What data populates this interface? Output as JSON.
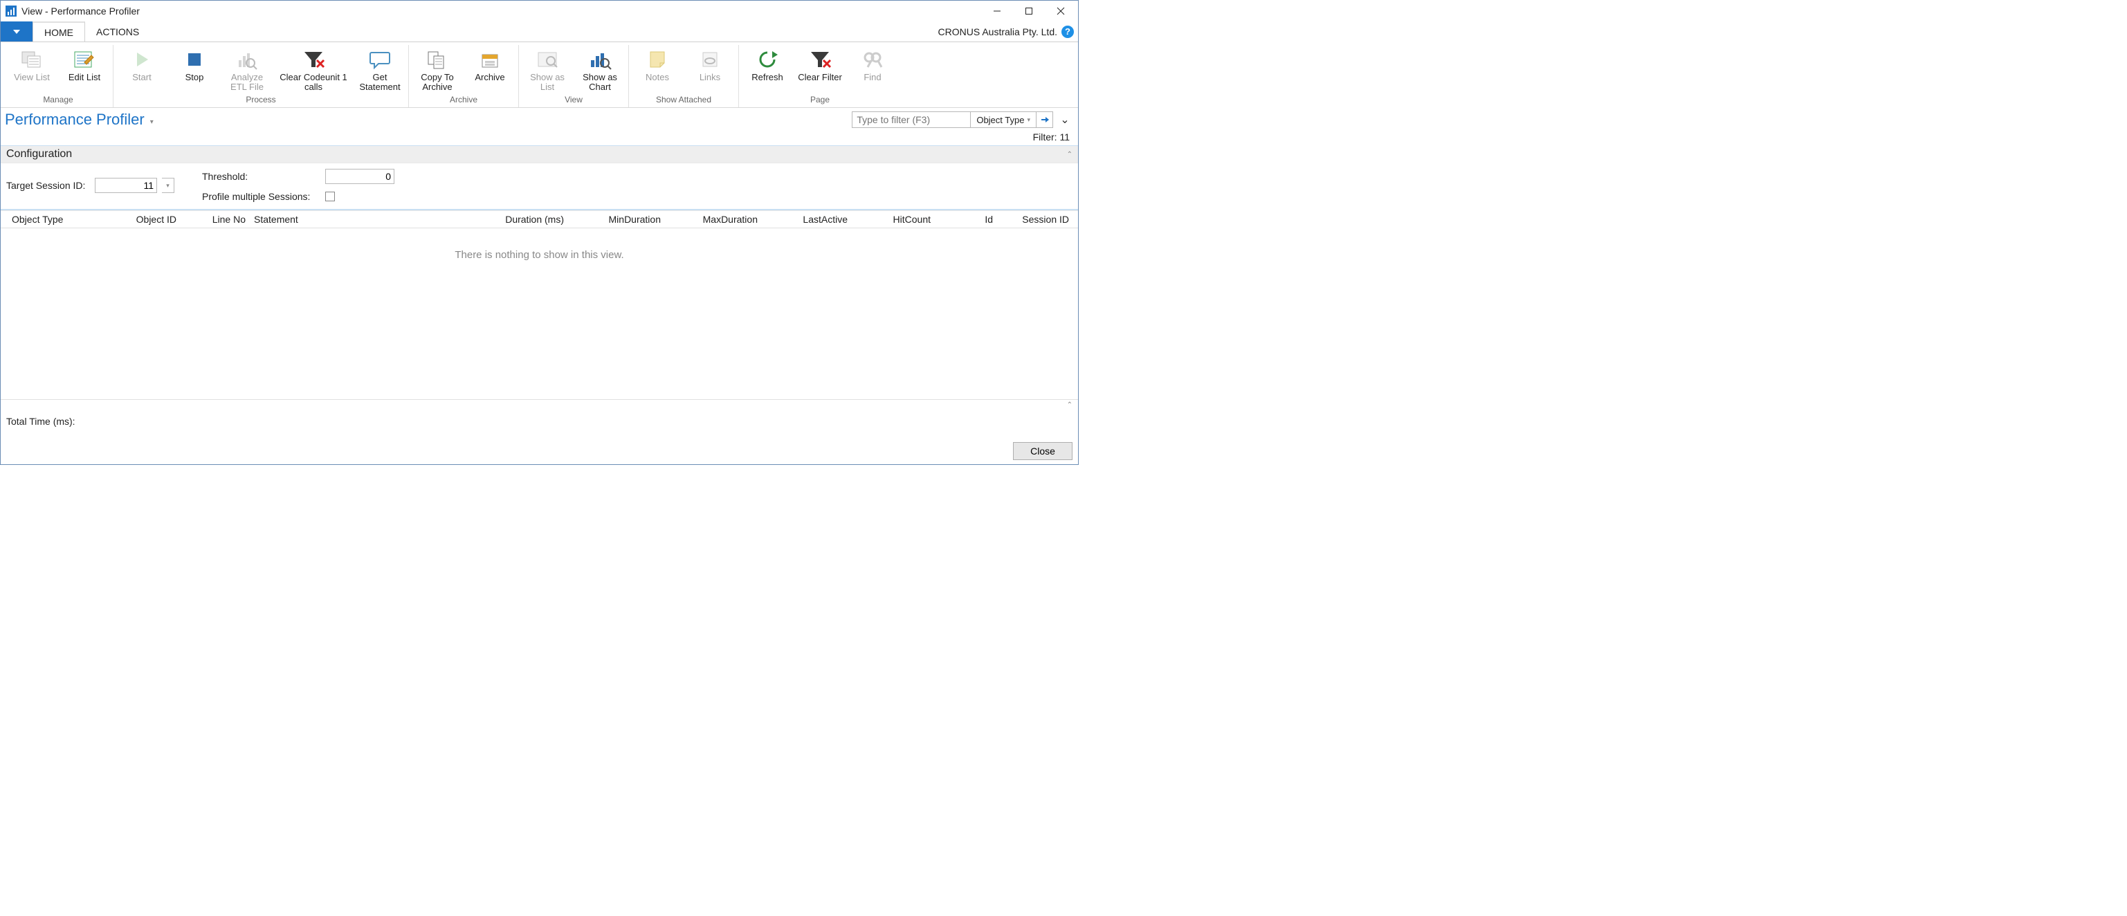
{
  "window": {
    "title": "View - Performance Profiler"
  },
  "tabs": {
    "file_arrow": "▼",
    "home": "HOME",
    "actions": "ACTIONS",
    "company": "CRONUS Australia Pty. Ltd."
  },
  "ribbon": {
    "groups": {
      "manage": {
        "label": "Manage",
        "view_list": "View List",
        "edit_list": "Edit List"
      },
      "process": {
        "label": "Process",
        "start": "Start",
        "stop": "Stop",
        "analyze": "Analyze ETL File",
        "clear_calls": "Clear Codeunit 1 calls",
        "get_stmt": "Get Statement"
      },
      "archive": {
        "label": "Archive",
        "copy_to": "Copy To Archive",
        "archive": "Archive"
      },
      "view": {
        "label": "View",
        "show_list": "Show as List",
        "show_chart": "Show as Chart"
      },
      "showattached": {
        "label": "Show Attached",
        "notes": "Notes",
        "links": "Links"
      },
      "page": {
        "label": "Page",
        "refresh": "Refresh",
        "clear_filter": "Clear Filter",
        "find": "Find"
      }
    }
  },
  "page": {
    "title": "Performance Profiler",
    "filter_placeholder": "Type to filter (F3)",
    "filter_column": "Object Type",
    "filter_status": "Filter: 11"
  },
  "config": {
    "header": "Configuration",
    "target_label": "Target Session ID:",
    "target_value": "11",
    "threshold_label": "Threshold:",
    "threshold_value": "0",
    "profile_multi_label": "Profile multiple Sessions:"
  },
  "grid": {
    "headers": {
      "object_type": "Object Type",
      "object_id": "Object ID",
      "line_no": "Line No",
      "statement": "Statement",
      "duration": "Duration (ms)",
      "min_duration": "MinDuration",
      "max_duration": "MaxDuration",
      "last_active": "LastActive",
      "hit_count": "HitCount",
      "id": "Id",
      "session_id": "Session ID"
    },
    "empty_text": "There is nothing to show in this view."
  },
  "footer": {
    "total_time": "Total Time (ms):"
  },
  "close_button": "Close"
}
